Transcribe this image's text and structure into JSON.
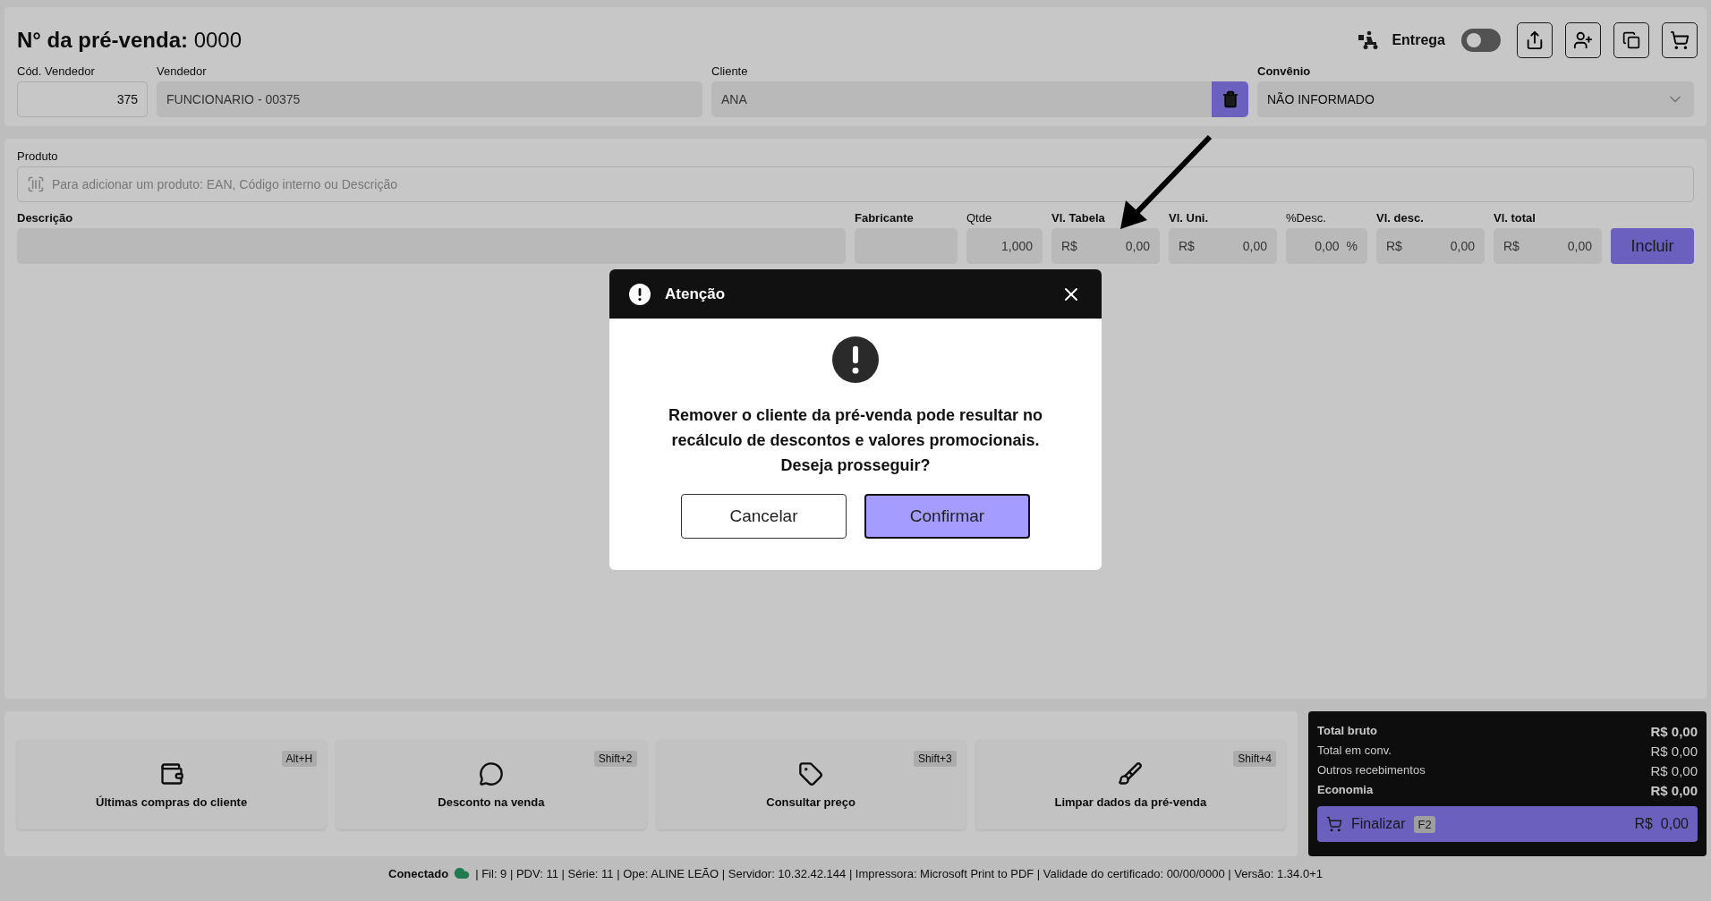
{
  "header": {
    "title_label": "N° da pré-venda:",
    "number": "0000",
    "delivery": {
      "label": "Entrega",
      "on": false
    }
  },
  "seller_code": {
    "label": "Cód. Vendedor",
    "value": "375"
  },
  "seller": {
    "label": "Vendedor",
    "value": "FUNCIONARIO - 00375"
  },
  "client": {
    "label": "Cliente",
    "value": "ANA"
  },
  "agreement": {
    "label": "Convênio",
    "value": "NÃO INFORMADO"
  },
  "product": {
    "label": "Produto",
    "placeholder": "Para adicionar um produto: EAN, Código interno ou Descrição"
  },
  "item_fields": [
    {
      "kind": "text",
      "label": "Descrição",
      "bold": true
    },
    {
      "kind": "text",
      "label": "Fabricante",
      "bold": true
    },
    {
      "kind": "number",
      "label": "Qtde",
      "bold": false,
      "value": "1,000"
    },
    {
      "kind": "money",
      "label": "Vl. Tabela",
      "bold": true,
      "prefix": "R$",
      "value": "0,00"
    },
    {
      "kind": "money",
      "label": "Vl. Uni.",
      "bold": true,
      "prefix": "R$",
      "value": "0,00"
    },
    {
      "kind": "percent",
      "label": "%Desc.",
      "bold": false,
      "value": "0,00",
      "suffix": "%"
    },
    {
      "kind": "money",
      "label": "Vl. desc.",
      "bold": true,
      "prefix": "R$",
      "value": "0,00"
    },
    {
      "kind": "money",
      "label": "Vl. total",
      "bold": true,
      "prefix": "R$",
      "value": "0,00"
    }
  ],
  "include_button": "Incluir",
  "actions": [
    {
      "label": "Últimas compras do cliente",
      "shortcut": "Alt+H"
    },
    {
      "label": "Desconto na venda",
      "shortcut": "Shift+2"
    },
    {
      "label": "Consultar preço",
      "shortcut": "Shift+3"
    },
    {
      "label": "Limpar dados da pré-venda",
      "shortcut": "Shift+4"
    }
  ],
  "totals": [
    {
      "label": "Total bruto",
      "value": "R$ 0,00",
      "bold": true
    },
    {
      "label": "Total em conv.",
      "value": "R$ 0,00",
      "bold": false
    },
    {
      "label": "Outros recebimentos",
      "value": "R$ 0,00",
      "bold": false
    },
    {
      "label": "Economia",
      "value": "R$ 0,00",
      "bold": true
    }
  ],
  "finalize": {
    "label": "Finalizar",
    "key": "F2",
    "currency": "R$",
    "value": "0,00"
  },
  "status_bar": {
    "connection": "Conectado",
    "details": "| Fil: 9 | PDV: 11 | Série: 11 | Ope: ALINE LEÃO | Servidor: 10.32.42.144 | Impressora: Microsoft Print to PDF | Validade do certificado: 00/00/0000 | Versão: 1.34.0+1"
  },
  "dialog": {
    "title": "Atenção",
    "message": "Remover o cliente da pré-venda pode resultar no recálculo de descontos e valores promocionais. Deseja prosseguir?",
    "cancel": "Cancelar",
    "confirm": "Confirmar"
  }
}
